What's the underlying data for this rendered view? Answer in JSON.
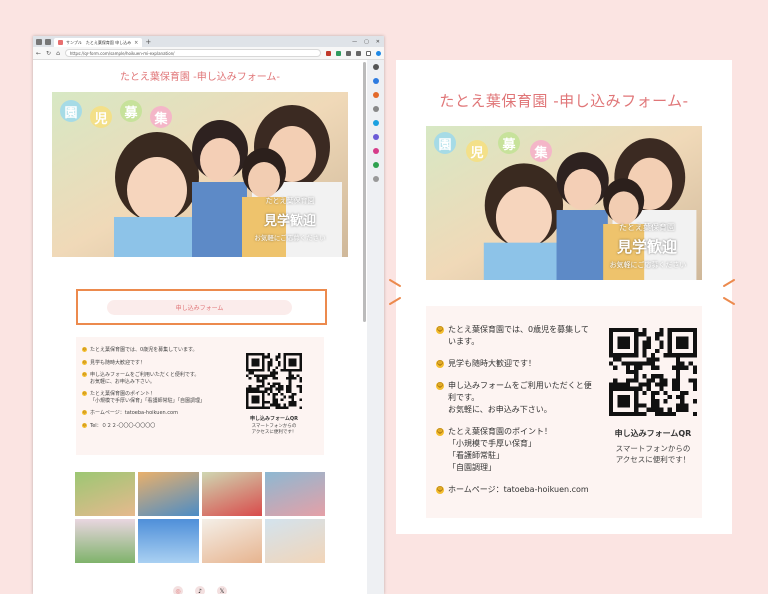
{
  "browser": {
    "tab_title": "サンプル　たとえ葉保育園 申し込み",
    "url": "https://qr-form.com/sample/hoikuen-mi-explanation/",
    "win_controls": [
      "—",
      "▢",
      "✕"
    ]
  },
  "page": {
    "title": "たとえ葉保育園 -申し込みフォーム-",
    "hero": {
      "bubbles": [
        "園",
        "児",
        "募",
        "集"
      ],
      "school": "たとえ葉保育園",
      "headline": "見学歓迎",
      "sub": "お気軽にご応募ください"
    },
    "form_button": "申し込みフォーム",
    "info": {
      "items": [
        "たとえ葉保育園では、0歳児を募集しています。",
        "見学も随時大歓迎です！",
        "申し込みフォームをご利用いただくと便利です。\nお気軽に、お申込み下さい。",
        "たとえ葉保育園のポイント！\n「小規模で手厚い保育」「看護師常駐」「自園調理」",
        "ホームページ：tatoeba-hoikuen.com",
        "Tel：０２２-〇〇〇-〇〇〇〇"
      ],
      "qr_title": "申し込みフォームQR",
      "qr_caption": "スマートフォンからの\nアクセスに便利です！"
    },
    "social": [
      "instagram",
      "tiktok",
      "x"
    ]
  },
  "zoom": {
    "title": "たとえ葉保育園 -申し込みフォーム-",
    "hero": {
      "bubbles": [
        "園",
        "児",
        "募",
        "集"
      ],
      "school": "たとえ葉保育園",
      "headline": "見学歓迎",
      "sub": "お気軽にご応募ください"
    },
    "info": {
      "items": [
        "たとえ葉保育園では、0歳児を募集しています。",
        "見学も随時大歓迎です！",
        "申し込みフォームをご利用いただくと便利です。\nお気軽に、お申込み下さい。",
        "たとえ葉保育園のポイント！\n「小規模で手厚い保育」\n「看護師常駐」\n「自園調理」",
        "ホームページ：tatoeba-hoikuen.com"
      ],
      "qr_title": "申し込みフォームQR",
      "qr_caption": "スマートフォンからの\nアクセスに便利です！"
    }
  },
  "colors": {
    "accent": "#e07678",
    "highlight": "#ec8a4d",
    "card_bg": "#fdf4f2",
    "bg": "#fbe4e2"
  }
}
